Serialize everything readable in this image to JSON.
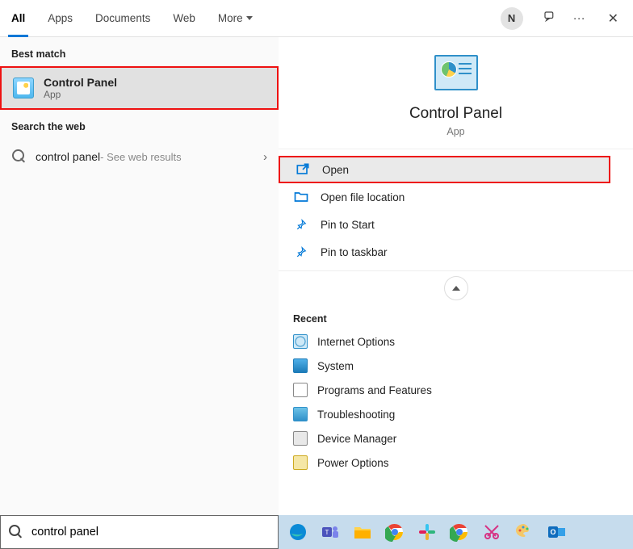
{
  "tabs": {
    "items": [
      "All",
      "Apps",
      "Documents",
      "Web",
      "More"
    ],
    "active_index": 0,
    "user_initial": "N"
  },
  "left": {
    "best_match_label": "Best match",
    "result_title": "Control Panel",
    "result_sub": "App",
    "search_web_label": "Search the web",
    "web_query": "control panel",
    "web_hint": " - See web results"
  },
  "detail": {
    "title": "Control Panel",
    "sub": "App",
    "actions": {
      "open": "Open",
      "open_loc": "Open file location",
      "pin_start": "Pin to Start",
      "pin_taskbar": "Pin to taskbar"
    },
    "recent_label": "Recent",
    "recent": [
      "Internet Options",
      "System",
      "Programs and Features",
      "Troubleshooting",
      "Device Manager",
      "Power Options"
    ]
  },
  "search": {
    "value": "control panel"
  },
  "taskbar_icons": [
    "edge",
    "teams",
    "files",
    "chrome",
    "slack",
    "chrome2",
    "snip",
    "paint",
    "outlook"
  ]
}
